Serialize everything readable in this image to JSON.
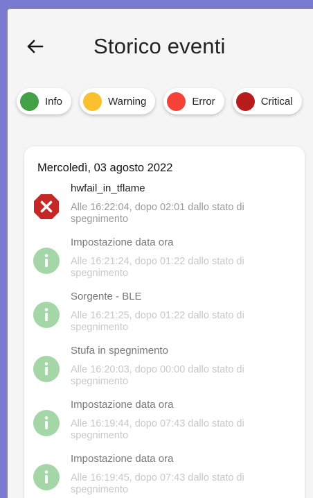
{
  "header": {
    "title": "Storico eventi",
    "back_icon": "arrow-left-icon"
  },
  "filters": [
    {
      "label": "Info",
      "color": "#43a047"
    },
    {
      "label": "Warning",
      "color": "#fbc02d"
    },
    {
      "label": "Error",
      "color": "#f44336"
    },
    {
      "label": "Critical",
      "color": "#b71c1c"
    }
  ],
  "group": {
    "date": "Mercoledì, 03 agosto 2022",
    "events": [
      {
        "type": "error",
        "icon": "error-octagon-icon",
        "name": "hwfail_in_tflame",
        "desc": "Alle 16:22:04, dopo 02:01 dallo stato di spegnimento"
      },
      {
        "type": "info",
        "icon": "info-icon",
        "name": "Impostazione data ora",
        "desc": "Alle 16:21:24, dopo 01:22 dallo stato di spegnimento"
      },
      {
        "type": "info",
        "icon": "info-icon",
        "name": "Sorgente - BLE",
        "desc": "Alle 16:21:25, dopo 01:22 dallo stato di spegnimento"
      },
      {
        "type": "info",
        "icon": "info-icon",
        "name": "Stufa in spegnimento",
        "desc": "Alle 16:20:03, dopo 00:00 dallo stato di spegnimento"
      },
      {
        "type": "info",
        "icon": "info-icon",
        "name": "Impostazione data ora",
        "desc": "Alle 16:19:44, dopo 07:43 dallo stato di spegnimento"
      },
      {
        "type": "info",
        "icon": "info-icon",
        "name": "Impostazione data ora",
        "desc": "Alle 16:19:45, dopo 07:43 dallo stato di spegnimento"
      }
    ]
  },
  "colors": {
    "info_icon_bg": "#a5d6a7",
    "error_icon_bg": "#c62828"
  }
}
